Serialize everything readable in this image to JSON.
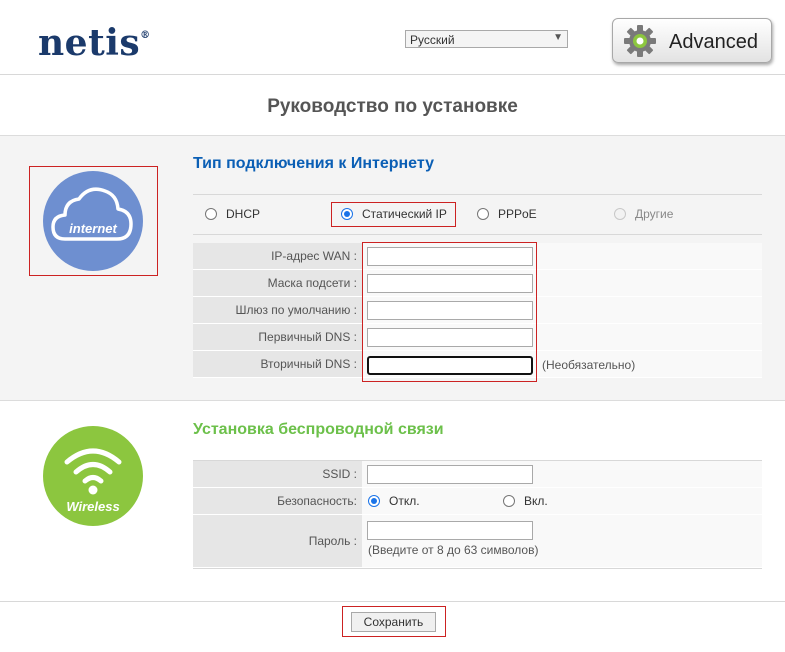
{
  "header": {
    "logo_text": "netis",
    "logo_mark": "®",
    "language_selected": "Русский",
    "advanced_label": "Advanced"
  },
  "page_title": "Руководство по установке",
  "internet": {
    "icon_label": "internet",
    "heading": "Тип подключения к Интернету",
    "connection_types": [
      {
        "label": "DHCP",
        "selected": false,
        "disabled": false
      },
      {
        "label": "Статический IP",
        "selected": true,
        "disabled": false
      },
      {
        "label": "PPPoE",
        "selected": false,
        "disabled": false
      },
      {
        "label": "Другие",
        "selected": false,
        "disabled": true
      }
    ],
    "fields": [
      {
        "label": "IP-адрес WAN :",
        "value": ""
      },
      {
        "label": "Маска подсети :",
        "value": ""
      },
      {
        "label": "Шлюз по умолчанию :",
        "value": ""
      },
      {
        "label": "Первичный DNS :",
        "value": ""
      },
      {
        "label": "Вторичный DNS :",
        "value": ""
      }
    ],
    "optional_note": "(Необязательно)"
  },
  "wireless": {
    "icon_label": "Wireless",
    "heading": "Установка беспроводной связи",
    "ssid_label": "SSID :",
    "ssid_value": "",
    "security_label": "Безопасность:",
    "security_off": "Откл.",
    "security_on": "Вкл.",
    "password_label": "Пароль :",
    "password_value": "",
    "password_hint": "(Введите от 8 до 63 символов)"
  },
  "save_label": "Сохранить",
  "colors": {
    "brand_navy": "#1b3a6b",
    "internet_blue": "#0b5fb5",
    "internet_circle": "#6e8fd0",
    "wireless_green": "#6cc04a",
    "wireless_circle": "#8cc63f",
    "highlight_red": "#cc2222"
  }
}
